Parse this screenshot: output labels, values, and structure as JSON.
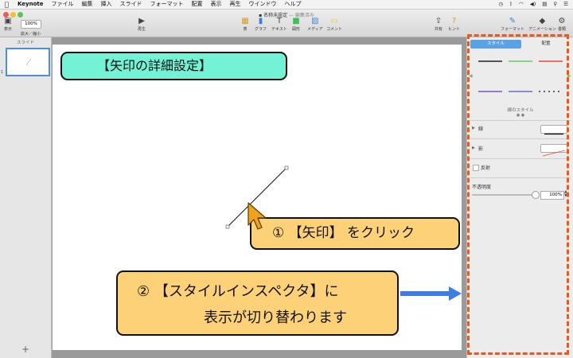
{
  "menubar": {
    "apple_icon": "apple-icon",
    "items": [
      "Keynote",
      "ファイル",
      "編集",
      "挿入",
      "スライド",
      "フォーマット",
      "配置",
      "表示",
      "再生",
      "ウインドウ",
      "ヘルプ"
    ]
  },
  "window": {
    "doc_title": "名称未設定",
    "doc_status": "— 編集済み"
  },
  "toolbar": {
    "zoom_value": "100%",
    "view_label": "表示",
    "zoom_label": "拡大／縮小",
    "play_label": "再生",
    "table_label": "表",
    "chart_label": "グラフ",
    "text_label": "テキスト",
    "shape_label": "図形",
    "media_label": "メディア",
    "comment_label": "コメント",
    "share_label": "共有",
    "tips_label": "ヒント",
    "format_label": "フォーマット",
    "animate_label": "アニメーション",
    "document_label": "書類"
  },
  "navigator": {
    "header": "スライド",
    "slide_number": "1",
    "add_label": "+"
  },
  "inspector": {
    "tab_style": "スタイル",
    "tab_arrange": "配置",
    "style_caption": "線のスタイル",
    "page_dots": "● ●",
    "line_label": "線",
    "shadow_label": "影",
    "reflection_label": "反射",
    "opacity_label": "不透明度",
    "opacity_value": "100%",
    "swatch_colors": [
      "#222222",
      "#6cc86a",
      "#e84b3c",
      "#7b4fc9",
      "#6b6bd6",
      "#333333"
    ]
  },
  "annotations": {
    "title": "【矢印の詳細設定】",
    "step1": "① 【矢印】 をクリック",
    "step2_line1": "② 【スタイルインスペクタ】に",
    "step2_line2": "表示が切り替わります"
  },
  "colors": {
    "accent_blue": "#4a8fdc",
    "callout_teal": "#74f2d6",
    "callout_orange": "#fdd178",
    "arrow_blue": "#3d7ee0",
    "frame_red": "#e85a1e"
  }
}
